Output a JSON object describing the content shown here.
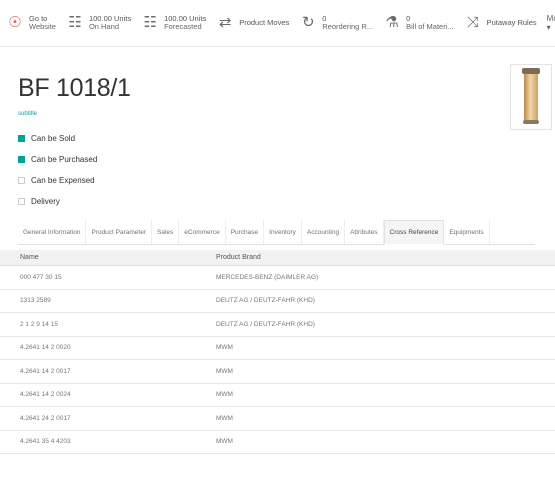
{
  "smart_buttons": [
    {
      "icon": "globe-icon",
      "glyph": "☉",
      "line1": "Go to",
      "line2": "Website",
      "red": true
    },
    {
      "icon": "cubes-icon",
      "glyph": "☷",
      "line1": "100.00 Units",
      "line2": "On Hand",
      "red": false
    },
    {
      "icon": "cubes-icon",
      "glyph": "☷",
      "line1": "100.00 Units",
      "line2": "Forecasted",
      "red": false
    },
    {
      "icon": "exchange-icon",
      "glyph": "⇄",
      "line1": "Product Moves",
      "line2": "",
      "red": false
    },
    {
      "icon": "refresh-icon",
      "glyph": "↻",
      "line1": "0",
      "line2": "Reordering R...",
      "red": false
    },
    {
      "icon": "flask-icon",
      "glyph": "⚗",
      "line1": "0",
      "line2": "Bill of Materi...",
      "red": false
    },
    {
      "icon": "random-icon",
      "glyph": "⤨",
      "line1": "Putaway Rules",
      "line2": "",
      "red": false
    }
  ],
  "more_label": "More ▾",
  "product": {
    "title": "BF 1018/1",
    "link": "subtitle",
    "checkboxes": [
      {
        "label": "Can be Sold",
        "checked": true
      },
      {
        "label": "Can be Purchased",
        "checked": true
      },
      {
        "label": "Can be Expensed",
        "checked": false
      },
      {
        "label": "Delivery",
        "checked": false
      }
    ]
  },
  "tabs": [
    {
      "label": "General Information",
      "active": false
    },
    {
      "label": "Product Parameter",
      "active": false
    },
    {
      "label": "Sales",
      "active": false
    },
    {
      "label": "eCommerce",
      "active": false
    },
    {
      "label": "Purchase",
      "active": false
    },
    {
      "label": "Inventory",
      "active": false
    },
    {
      "label": "Accounting",
      "active": false
    },
    {
      "label": "Attributes",
      "active": false
    },
    {
      "label": "Cross Reference",
      "active": true
    },
    {
      "label": "Equipments",
      "active": false
    }
  ],
  "table": {
    "columns": [
      "Name",
      "Product Brand"
    ],
    "rows": [
      [
        "000 477 30 15",
        "MERCEDES-BENZ (DAIMLER AG)"
      ],
      [
        "1313 2589",
        "DEUTZ AG / DEUTZ-FAHR (KHD)"
      ],
      [
        "2 1 2 9 14 15",
        "DEUTZ AG / DEUTZ-FAHR (KHD)"
      ],
      [
        "4.2641 14 2 0020",
        "MWM"
      ],
      [
        "4.2641 14 2 0017",
        "MWM"
      ],
      [
        "4.2641 14 2 0024",
        "MWM"
      ],
      [
        "4.2641 24 2 0017",
        "MWM"
      ],
      [
        "4.2641 35 4 4203",
        "MWM"
      ]
    ]
  }
}
